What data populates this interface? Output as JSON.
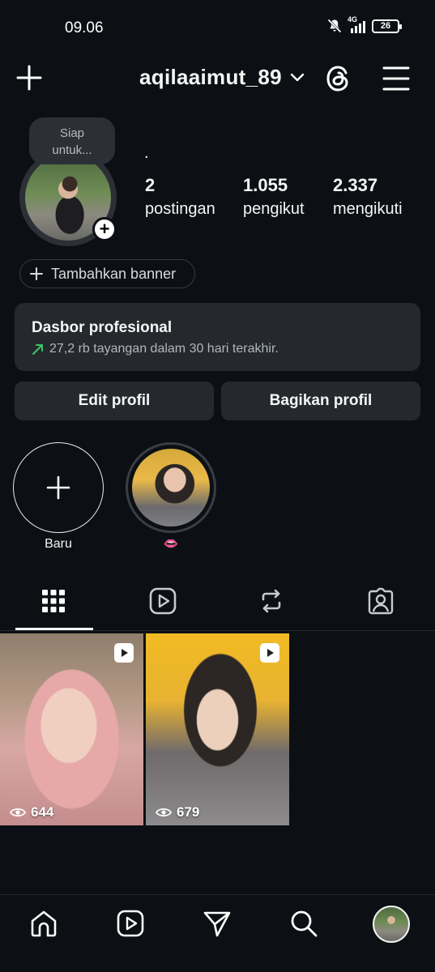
{
  "status_bar": {
    "time": "09.06",
    "network": "4G",
    "battery": "26"
  },
  "header": {
    "username": "aqilaaimut_89"
  },
  "profile": {
    "note": "Siap untuk...",
    "display_name": ".",
    "stats": [
      {
        "value": "2",
        "label": "postingan"
      },
      {
        "value": "1.055",
        "label": "pengikut"
      },
      {
        "value": "2.337",
        "label": "mengikuti"
      }
    ],
    "banner_button": "Tambahkan banner"
  },
  "dashboard": {
    "title": "Dasbor profesional",
    "subtitle": "27,2 rb tayangan dalam 30 hari terakhir."
  },
  "actions": {
    "edit": "Edit profil",
    "share": "Bagikan profil"
  },
  "highlights": [
    {
      "label": "Baru"
    },
    {
      "label": "👄"
    }
  ],
  "tabs": [
    "grid-icon",
    "reels-icon",
    "reposts-icon",
    "tagged-icon"
  ],
  "posts": [
    {
      "views": "644"
    },
    {
      "views": "679"
    }
  ],
  "colors": {
    "background": "#0c1014",
    "card": "#25292e",
    "accent_green": "#3ec56b",
    "text": "#f5f5f5"
  }
}
